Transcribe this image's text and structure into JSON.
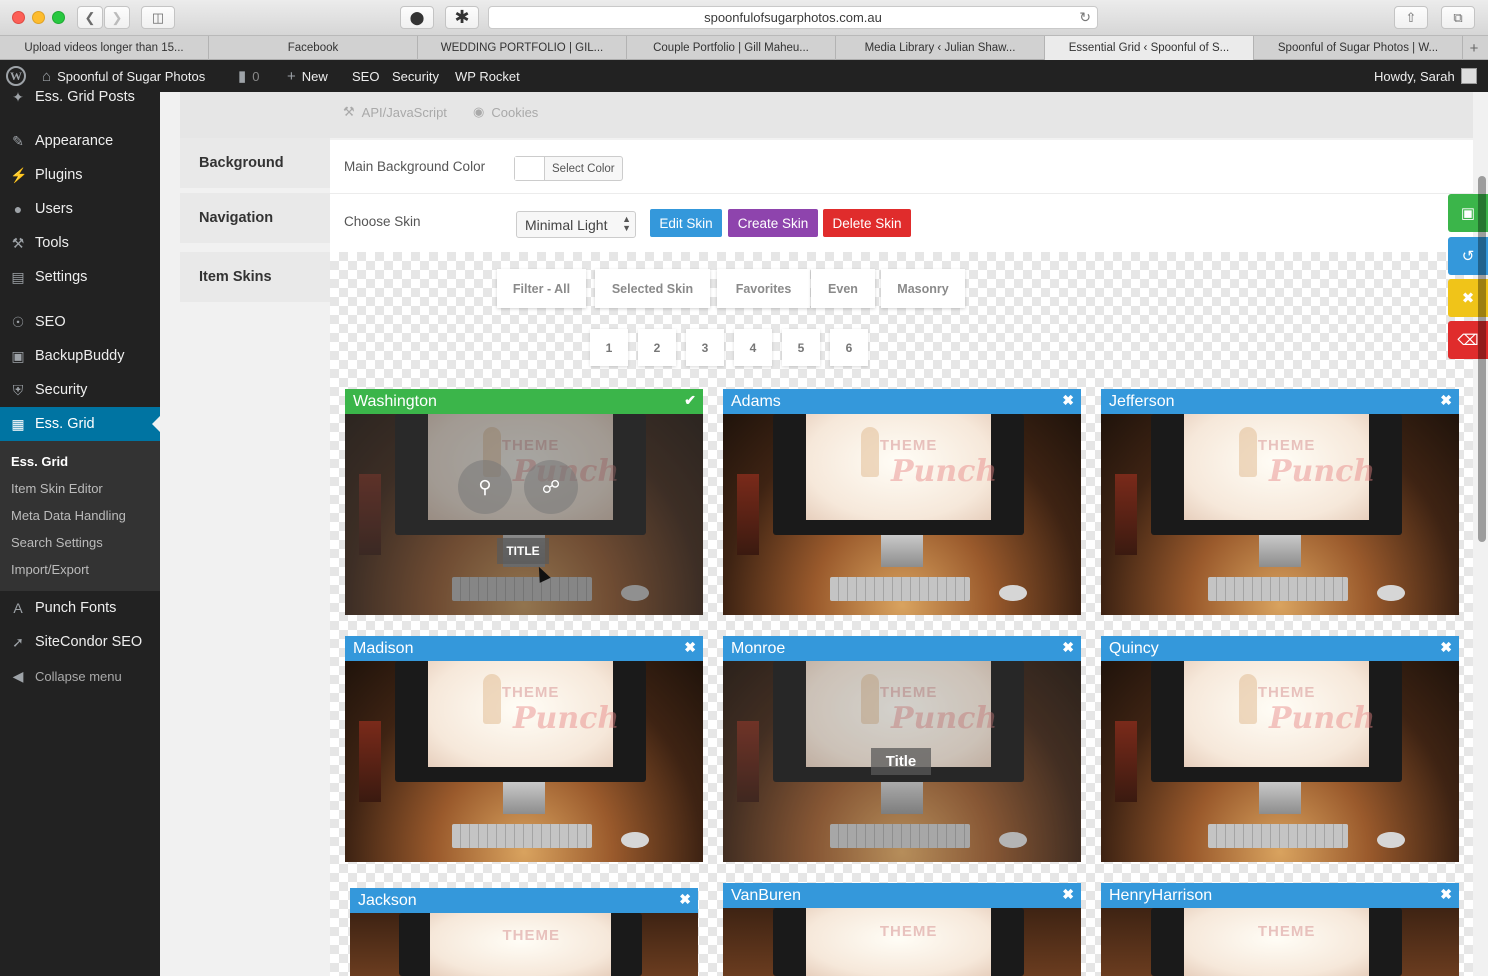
{
  "browser": {
    "url": "spoonfulofsugarphotos.com.au",
    "tabs": [
      {
        "label": "Upload videos longer than 15..."
      },
      {
        "label": "Facebook"
      },
      {
        "label": "WEDDING PORTFOLIO | GIL..."
      },
      {
        "label": "Couple Portfolio | Gill Maheu..."
      },
      {
        "label": "Media Library ‹ Julian Shaw..."
      },
      {
        "label": "Essential Grid ‹ Spoonful of S..."
      },
      {
        "label": "Spoonful of Sugar Photos | W..."
      }
    ],
    "active_tab": 5
  },
  "adminbar": {
    "site_name": "Spoonful of Sugar Photos",
    "comments": "0",
    "new": "New",
    "seo": "SEO",
    "security": "Security",
    "wp_rocket": "WP Rocket",
    "howdy": "Howdy, Sarah"
  },
  "sidebar": {
    "partial_item": "Ess. Grid Posts",
    "items": [
      {
        "label": "Appearance",
        "icon": "paintbrush-icon"
      },
      {
        "label": "Plugins",
        "icon": "plug-icon"
      },
      {
        "label": "Users",
        "icon": "user-icon"
      },
      {
        "label": "Tools",
        "icon": "wrench-icon"
      },
      {
        "label": "Settings",
        "icon": "sliders-icon"
      },
      {
        "label": "SEO",
        "icon": "seo-icon"
      },
      {
        "label": "BackupBuddy",
        "icon": "backup-icon"
      },
      {
        "label": "Security",
        "icon": "shield-icon"
      },
      {
        "label": "Ess. Grid",
        "icon": "grid-icon"
      }
    ],
    "submenu": [
      "Ess. Grid",
      "Item Skin Editor",
      "Meta Data Handling",
      "Search Settings",
      "Import/Export"
    ],
    "after": [
      {
        "label": "Punch Fonts",
        "icon": "font-icon"
      },
      {
        "label": "SiteCondor SEO",
        "icon": "condor-icon"
      },
      {
        "label": "Collapse menu",
        "icon": "collapse-icon"
      }
    ]
  },
  "top_tabs": [
    "API/JavaScript",
    "Cookies"
  ],
  "left_tabs": [
    "Background",
    "Navigation",
    "Item Skins"
  ],
  "background": {
    "label": "Main Background Color",
    "button": "Select Color"
  },
  "skin": {
    "label": "Choose Skin",
    "selected": "Minimal Light",
    "edit": "Edit Skin",
    "create": "Create Skin",
    "delete": "Delete Skin"
  },
  "filters": [
    "Filter - All",
    "Selected Skin",
    "Favorites",
    "Even",
    "Masonry"
  ],
  "pages": [
    "1",
    "2",
    "3",
    "4",
    "5",
    "6"
  ],
  "cards": [
    {
      "name": "Washington",
      "selected": true
    },
    {
      "name": "Adams"
    },
    {
      "name": "Jefferson"
    },
    {
      "name": "Madison"
    },
    {
      "name": "Monroe"
    },
    {
      "name": "Quincy"
    },
    {
      "name": "Jackson"
    },
    {
      "name": "VanBuren"
    },
    {
      "name": "HenryHarrison"
    }
  ],
  "hover_title_upper": "TITLE",
  "hover_title": "Title",
  "watermark": {
    "line1": "THEME",
    "line2": "Punch"
  },
  "colors": {
    "accent_blue": "#3498db",
    "selected_green": "#3bb54a",
    "edit_btn": "#3498db",
    "create_btn": "#8e44ad",
    "delete_btn": "#e02c2c",
    "save_btn": "#3bb54a",
    "refresh_btn": "#3498db",
    "close_btn": "#f0c419",
    "trash_btn": "#e02c2c"
  }
}
